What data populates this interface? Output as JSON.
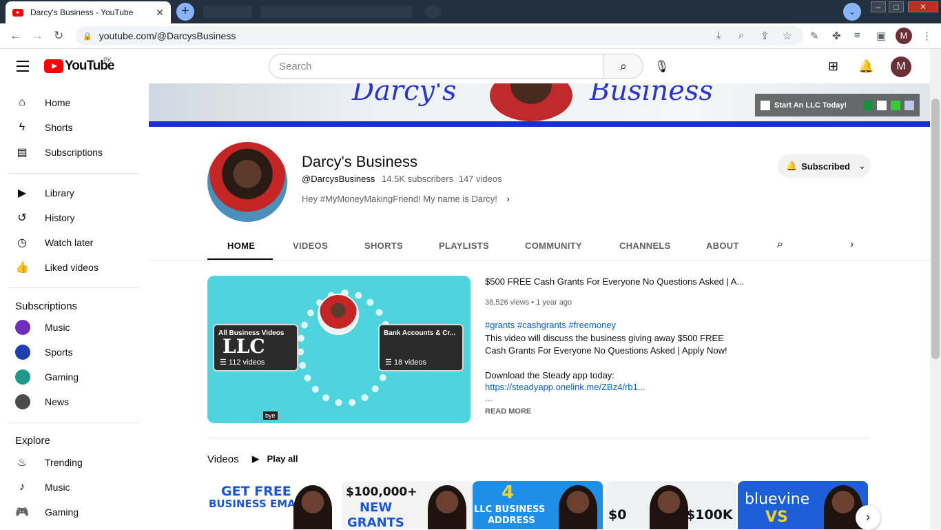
{
  "browser": {
    "tab_title": "Darcy's Business - YouTube",
    "tab_close": "✕",
    "new_tab": "+",
    "url": "youtube.com/@DarcysBusiness",
    "profile_initial": "M"
  },
  "masthead": {
    "logo_text": "YouTube",
    "region": "PK",
    "search_placeholder": "Search",
    "avatar_initial": "M"
  },
  "sidebar": {
    "main": [
      {
        "label": "Home",
        "icon": "home-icon"
      },
      {
        "label": "Shorts",
        "icon": "shorts-icon"
      },
      {
        "label": "Subscriptions",
        "icon": "subscriptions-icon"
      }
    ],
    "library": [
      {
        "label": "Library",
        "icon": "library-icon"
      },
      {
        "label": "History",
        "icon": "history-icon"
      },
      {
        "label": "Watch later",
        "icon": "watch-later-icon"
      },
      {
        "label": "Liked videos",
        "icon": "liked-icon"
      }
    ],
    "subscriptions_title": "Subscriptions",
    "subscriptions": [
      {
        "label": "Music",
        "color": "#6f2dbd"
      },
      {
        "label": "Sports",
        "color": "#1e3fae"
      },
      {
        "label": "Gaming",
        "color": "#1d9a8a"
      },
      {
        "label": "News",
        "color": "#4a4a4a"
      }
    ],
    "explore_title": "Explore",
    "explore": [
      {
        "label": "Trending",
        "icon": "trending-icon"
      },
      {
        "label": "Music",
        "icon": "music-icon"
      },
      {
        "label": "Gaming",
        "icon": "gaming-icon"
      }
    ]
  },
  "banner": {
    "word_left": "Darcy's",
    "word_right": "Business",
    "link_text": "Start An LLC Today!"
  },
  "channel": {
    "name": "Darcy's Business",
    "handle": "@DarcysBusiness",
    "subscribers": "14.5K subscribers",
    "videos": "147 videos",
    "description": "Hey #MyMoneyMakingFriend! My name is Darcy!",
    "subscribe_label": "Subscribed"
  },
  "tabs": [
    "HOME",
    "VIDEOS",
    "SHORTS",
    "PLAYLISTS",
    "COMMUNITY",
    "CHANNELS",
    "ABOUT"
  ],
  "featured": {
    "playlist_left_title": "All Business Videos",
    "playlist_left_big": "LLC",
    "playlist_left_count": "112 videos",
    "playlist_right_title": "Bank Accounts & Cr...",
    "playlist_right_count": "18 videos",
    "bye_tag": "bye",
    "title": "$500 FREE Cash Grants For Everyone No Questions Asked | A...",
    "views": "38,526 views",
    "age": "1 year ago",
    "tags": "#grants #cashgrants #freemoney",
    "body": "This video will discuss the business giving away $500 FREE Cash Grants For Everyone No Questions Asked | Apply Now!",
    "body2": "Download the Steady app today:",
    "link": "https://steadyapp.onelink.me/ZBz4/rb1...",
    "ellipsis": "...",
    "read_more": "READ MORE"
  },
  "videos_section": {
    "title": "Videos",
    "play_all": "Play all",
    "thumbs": [
      {
        "text1": "GET FREE",
        "text2": "BUSINESS EMAIL",
        "bg": "#ffffff"
      },
      {
        "text1": "$100,000+",
        "text2": "NEW",
        "text3": "GRANTS",
        "bg": "#f3f3f3"
      },
      {
        "text1": "4",
        "text2": "LLC BUSINESS",
        "text3": "ADDRESS",
        "bg": "#1f8ee6"
      },
      {
        "text1": "$0",
        "text2": "$100K",
        "bg": "#eef1f4"
      },
      {
        "text1": "bluevine",
        "text2": "VS",
        "bg": "#1d5fd6"
      }
    ]
  }
}
